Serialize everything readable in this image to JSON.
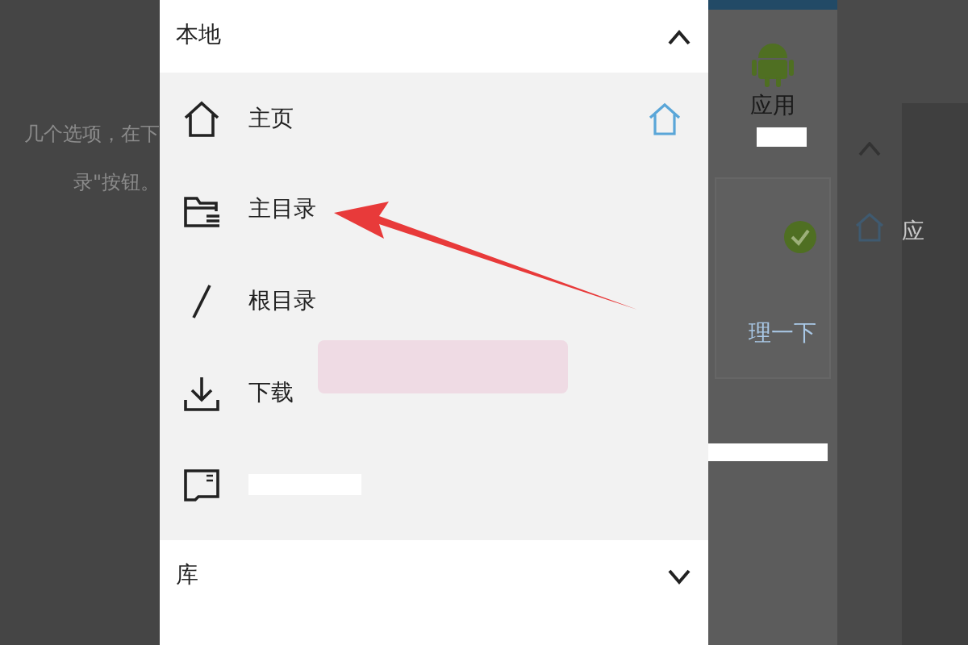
{
  "background_text": [
    "几个选项，在下",
    "录\"按钮。"
  ],
  "drawer": {
    "sections": [
      {
        "title": "本地",
        "expanded": true,
        "items": [
          {
            "kind": "home",
            "label": "主页",
            "default": true
          },
          {
            "kind": "folder",
            "label": "主目录",
            "default": false
          },
          {
            "kind": "root",
            "label": "根目录",
            "default": false
          },
          {
            "kind": "download",
            "label": "下载",
            "default": false
          },
          {
            "kind": "sd",
            "default": false
          }
        ]
      },
      {
        "title": "库",
        "expanded": false
      }
    ]
  },
  "background_app": {
    "app_label": "应用",
    "card_text": "理一下",
    "partial_label": "应"
  }
}
